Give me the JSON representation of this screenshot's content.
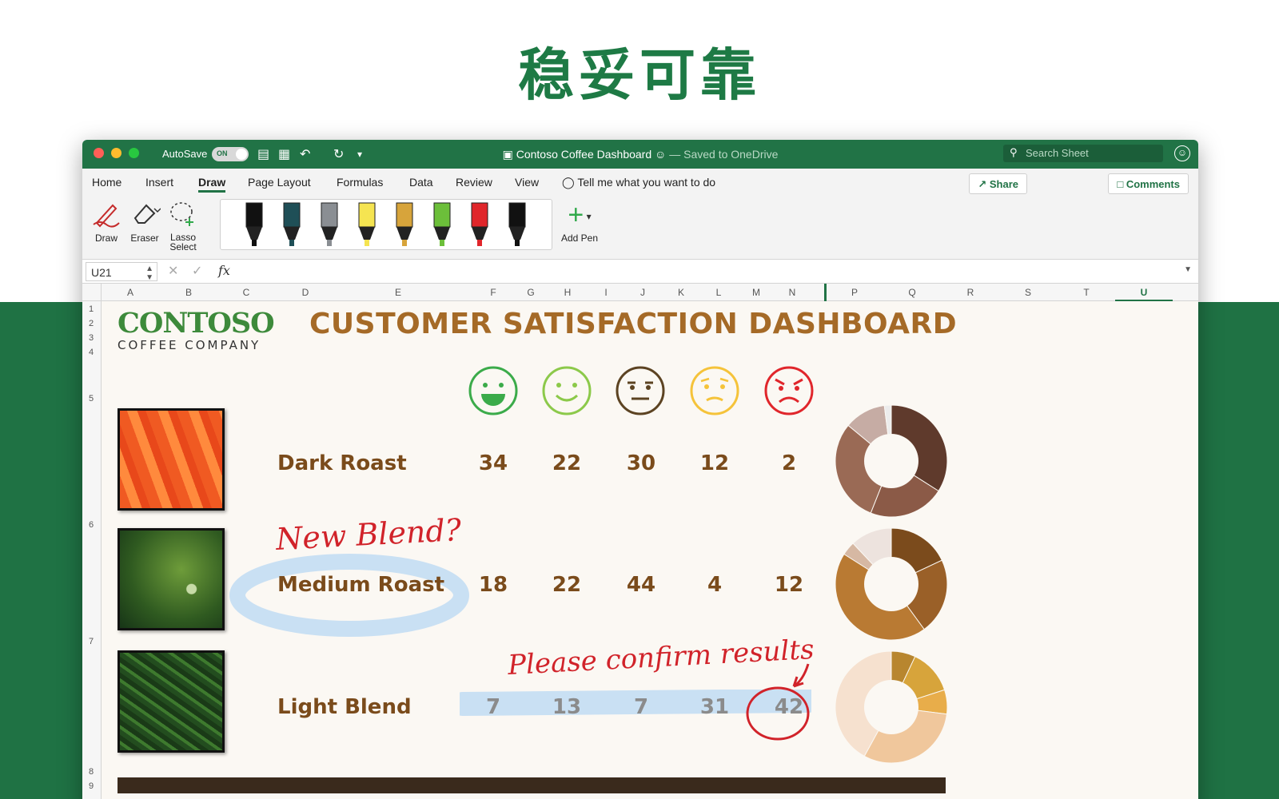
{
  "hero": {
    "title": "稳妥可靠"
  },
  "titlebar": {
    "autosave_label": "AutoSave",
    "autosave_state": "ON",
    "doc_title": "Contoso Coffee Dashboard",
    "saved_status": "— Saved to OneDrive",
    "search_placeholder": "Search Sheet"
  },
  "menu": {
    "tabs": [
      {
        "label": "Home"
      },
      {
        "label": "Insert"
      },
      {
        "label": "Draw",
        "active": true
      },
      {
        "label": "Page Layout"
      },
      {
        "label": "Formulas"
      },
      {
        "label": "Data"
      },
      {
        "label": "Review"
      },
      {
        "label": "View"
      }
    ],
    "tell_me": "Tell me what you want to do",
    "share_label": "Share",
    "comments_label": "Comments"
  },
  "ribbon": {
    "draw_label": "Draw",
    "eraser_label": "Eraser",
    "lasso_label_1": "Lasso",
    "lasso_label_2": "Select",
    "add_pen_label": "Add Pen",
    "pens": [
      {
        "name": "black-pen",
        "color": "#111111"
      },
      {
        "name": "teal-pen",
        "color": "#1f4f57"
      },
      {
        "name": "gray-pencil",
        "color": "#8a8e93"
      },
      {
        "name": "yellow-highlighter",
        "color": "#f5e451"
      },
      {
        "name": "gold-pen",
        "color": "#d7a43b"
      },
      {
        "name": "green-highlighter",
        "color": "#6cbf3a"
      },
      {
        "name": "red-pen",
        "color": "#e0262b"
      },
      {
        "name": "black-marker",
        "color": "#111111"
      }
    ]
  },
  "formula_bar": {
    "name_box": "U21",
    "fx_label": "fx"
  },
  "columns": [
    "A",
    "B",
    "C",
    "D",
    "E",
    "F",
    "G",
    "H",
    "I",
    "J",
    "K",
    "L",
    "M",
    "N",
    "P",
    "Q",
    "R",
    "S",
    "T",
    "U"
  ],
  "rows": [
    "1",
    "2",
    "3",
    "4",
    "5",
    "6",
    "7",
    "8",
    "9"
  ],
  "dashboard": {
    "logo_main": "CONTOSO",
    "logo_sub": "COFFEE COMPANY",
    "title": "CUSTOMER SATISFACTION DASHBOARD",
    "face_colors": [
      "#3bab4a",
      "#8cc94a",
      "#5c4322",
      "#f5c33a",
      "#e0262b"
    ],
    "products": [
      {
        "name": "Dark Roast",
        "values": [
          "34",
          "22",
          "30",
          "12",
          "2"
        ],
        "donut": [
          34,
          22,
          30,
          12,
          2
        ],
        "colors": [
          "#5f3a2c",
          "#8b5a47",
          "#9a6a55",
          "#c6aca4",
          "#ececec"
        ]
      },
      {
        "name": "Medium Roast",
        "values": [
          "18",
          "22",
          "44",
          "4",
          "12"
        ],
        "donut": [
          18,
          22,
          44,
          4,
          12
        ],
        "colors": [
          "#7b4b1c",
          "#9a6028",
          "#b97a33",
          "#d6b8a3",
          "#ede3de"
        ]
      },
      {
        "name": "Light Blend",
        "values": [
          "7",
          "13",
          "7",
          "31",
          "42"
        ],
        "donut": [
          7,
          13,
          7,
          31,
          42
        ],
        "colors": [
          "#b8862f",
          "#d7a43b",
          "#e8ad4a",
          "#f0c79c",
          "#f6e1cf"
        ]
      }
    ],
    "ink_new_blend": "New Blend?",
    "ink_confirm": "Please confirm results"
  }
}
